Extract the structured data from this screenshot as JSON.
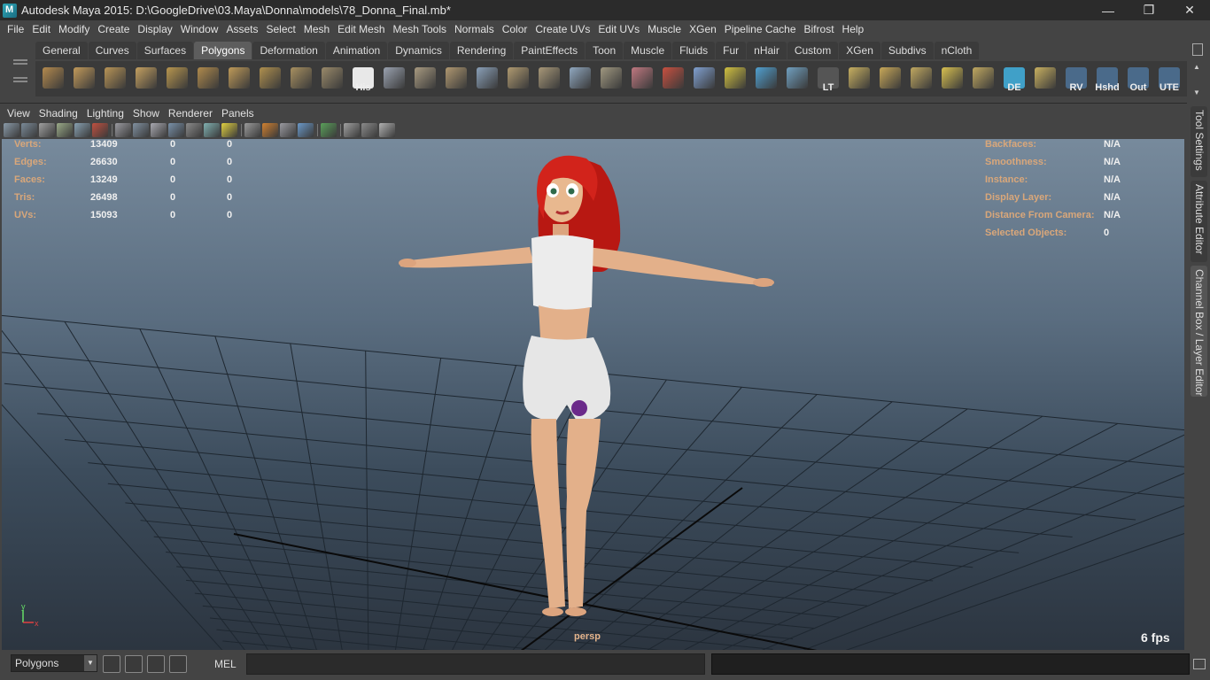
{
  "window": {
    "title": "Autodesk Maya 2015: D:\\GoogleDrive\\03.Maya\\Donna\\models\\78_Donna_Final.mb*",
    "buttons": [
      "—",
      "❐",
      "✕"
    ]
  },
  "menubar": [
    "File",
    "Edit",
    "Modify",
    "Create",
    "Display",
    "Window",
    "Assets",
    "Select",
    "Mesh",
    "Edit Mesh",
    "Mesh Tools",
    "Normals",
    "Color",
    "Create UVs",
    "Edit UVs",
    "Muscle",
    "XGen",
    "Pipeline Cache",
    "Bifrost",
    "Help"
  ],
  "shelf": {
    "tabs": [
      "General",
      "Curves",
      "Surfaces",
      "Polygons",
      "Deformation",
      "Animation",
      "Dynamics",
      "Rendering",
      "PaintEffects",
      "Toon",
      "Muscle",
      "Fluids",
      "Fur",
      "nHair",
      "Custom",
      "XGen",
      "Subdivs",
      "nCloth"
    ],
    "active_tab": "Polygons",
    "icons": [
      {
        "name": "poly-sphere-icon",
        "label": "",
        "color": "#b48a4e"
      },
      {
        "name": "poly-cube-icon",
        "label": "",
        "color": "#c29a5a"
      },
      {
        "name": "poly-cylinder-icon",
        "label": "",
        "color": "#b89456"
      },
      {
        "name": "poly-cone-icon",
        "label": "",
        "color": "#c4a060"
      },
      {
        "name": "poly-plane-icon",
        "label": "",
        "color": "#b8964e"
      },
      {
        "name": "poly-torus-icon",
        "label": "",
        "color": "#b08a4c"
      },
      {
        "name": "poly-pyramid-icon",
        "label": "",
        "color": "#bf9a58"
      },
      {
        "name": "poly-pipe-icon",
        "label": "",
        "color": "#b0904e"
      },
      {
        "name": "create-polygon-tool-icon",
        "label": "",
        "color": "#a89060"
      },
      {
        "name": "sculpt-geometry-icon",
        "label": "",
        "color": "#9a8a6a"
      },
      {
        "name": "history-icon",
        "label": "His",
        "color": "#e8e8e8"
      },
      {
        "name": "extrude-icon",
        "label": "",
        "color": "#9aa2b0"
      },
      {
        "name": "bridge-icon",
        "label": "",
        "color": "#a89a80"
      },
      {
        "name": "append-polygon-icon",
        "label": "",
        "color": "#b09870"
      },
      {
        "name": "split-polygon-icon",
        "label": "",
        "color": "#8aa0b8"
      },
      {
        "name": "insert-edge-loop-icon",
        "label": "",
        "color": "#b09a70"
      },
      {
        "name": "offset-edge-loop-icon",
        "label": "",
        "color": "#a89878"
      },
      {
        "name": "merge-vertices-icon",
        "label": "",
        "color": "#90a8c0"
      },
      {
        "name": "combine-icon",
        "label": "",
        "color": "#a09880"
      },
      {
        "name": "cut-faces-icon",
        "label": "",
        "color": "#c07880"
      },
      {
        "name": "paint-tool-icon",
        "label": "",
        "color": "#c85040"
      },
      {
        "name": "wireframe-cage-icon",
        "label": "",
        "color": "#80a0d0"
      },
      {
        "name": "target-snap-icon",
        "label": "",
        "color": "#d0c040"
      },
      {
        "name": "manipulator-icon",
        "label": "",
        "color": "#50a0d0"
      },
      {
        "name": "render-node-icon",
        "label": "",
        "color": "#70a0c0"
      },
      {
        "name": "lt-script-icon",
        "label": "LT",
        "color": "#555555"
      },
      {
        "name": "uv-layout-icon",
        "label": "",
        "color": "#c8b060"
      },
      {
        "name": "uv-cut-icon",
        "label": "",
        "color": "#c8a858"
      },
      {
        "name": "uv-sew-icon",
        "label": "",
        "color": "#c0a860"
      },
      {
        "name": "uv-unfold-icon",
        "label": "",
        "color": "#d8c050"
      },
      {
        "name": "uv-relax-icon",
        "label": "",
        "color": "#c0a860"
      },
      {
        "name": "de-script-icon",
        "label": "DE",
        "color": "#40a0c8"
      },
      {
        "name": "uv-grid-icon",
        "label": "",
        "color": "#c8b060"
      },
      {
        "name": "rv-script-icon",
        "label": "RV",
        "color": "#4a6a8a"
      },
      {
        "name": "hshd-script-icon",
        "label": "Hshd",
        "color": "#4a6a8a"
      },
      {
        "name": "out-script-icon",
        "label": "Out",
        "color": "#4a6a8a"
      },
      {
        "name": "ute-script-icon",
        "label": "UTE",
        "color": "#4a6a8a"
      }
    ]
  },
  "panel": {
    "menus": [
      "View",
      "Shading",
      "Lighting",
      "Show",
      "Renderer",
      "Panels"
    ],
    "toolbar_icons": [
      "select-camera-icon",
      "camera-attributes-icon",
      "bookmark-icon",
      "image-plane-icon",
      "two-d-pan-icon",
      "grease-pencil-icon",
      "sep",
      "wireframe-icon",
      "grid-icon",
      "smooth-shade-icon",
      "flat-shade-icon",
      "xray-icon",
      "texture-icon",
      "lights-icon",
      "sep",
      "shadow-icon",
      "ao-icon",
      "motion-blur-icon",
      "anti-alias-icon",
      "sep",
      "isolate-select-icon",
      "sep",
      "xray-joints-icon",
      "backface-icon",
      "hud-icon"
    ]
  },
  "hud_left": [
    {
      "label": "Verts:",
      "values": [
        "13409",
        "0",
        "0"
      ]
    },
    {
      "label": "Edges:",
      "values": [
        "26630",
        "0",
        "0"
      ]
    },
    {
      "label": "Faces:",
      "values": [
        "13249",
        "0",
        "0"
      ]
    },
    {
      "label": "Tris:",
      "values": [
        "26498",
        "0",
        "0"
      ]
    },
    {
      "label": "UVs:",
      "values": [
        "15093",
        "0",
        "0"
      ]
    }
  ],
  "hud_right": [
    {
      "label": "Backfaces:",
      "value": "N/A"
    },
    {
      "label": "Smoothness:",
      "value": "N/A"
    },
    {
      "label": "Instance:",
      "value": "N/A"
    },
    {
      "label": "Display Layer:",
      "value": "N/A"
    },
    {
      "label": "Distance From Camera:",
      "value": "N/A"
    },
    {
      "label": "Selected Objects:",
      "value": "0"
    }
  ],
  "viewport": {
    "camera": "persp",
    "fps": "6 fps",
    "axis_labels": {
      "x": "x",
      "y": "y"
    },
    "colors": {
      "hair": "#c81f1a",
      "skin": "#e3b08a",
      "clothing": "#e8e8e8",
      "logo": "#6b2a8a",
      "hud_label": "#d9a77a"
    }
  },
  "dock_tabs": [
    "Tool Settings",
    "Attribute Editor",
    "Channel Box / Layer Editor"
  ],
  "cmdline": {
    "mode": "Polygons",
    "mel_label": "MEL",
    "input_value": "",
    "output_value": ""
  }
}
